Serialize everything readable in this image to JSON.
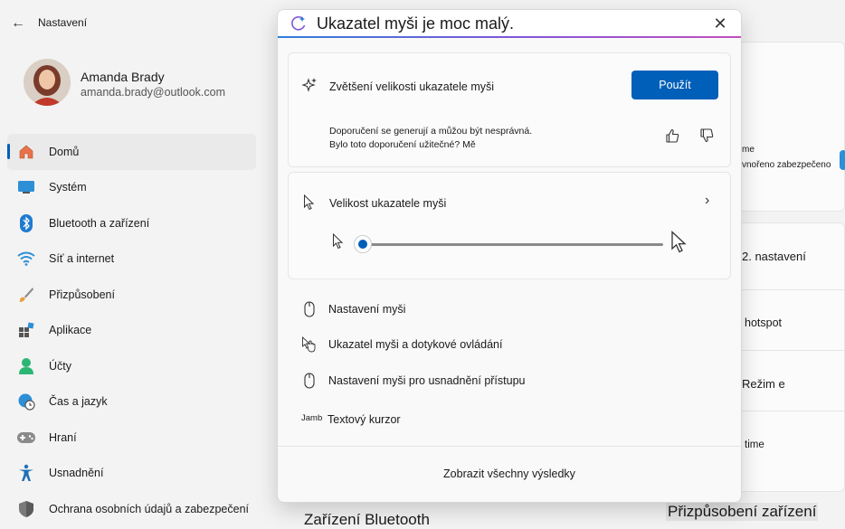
{
  "window": {
    "back_label": "←",
    "title": "Nastavení"
  },
  "profile": {
    "name": "Amanda Brady",
    "email": "amanda.brady@outlook.com"
  },
  "sidebar": {
    "items": [
      {
        "label": "Domů",
        "icon": "home-icon",
        "active": true
      },
      {
        "label": "Systém",
        "icon": "system-monitor-icon"
      },
      {
        "label": "Bluetooth a zařízení",
        "icon": "bluetooth-icon"
      },
      {
        "label": "Síť a internet",
        "icon": "wifi-icon"
      },
      {
        "label": "Přizpůsobení",
        "icon": "brush-icon"
      },
      {
        "label": "Aplikace",
        "icon": "apps-icon"
      },
      {
        "label": "Účty",
        "icon": "person-icon"
      },
      {
        "label": "Čas a jazyk",
        "icon": "globe-clock-icon"
      },
      {
        "label": "Hraní",
        "icon": "gamepad-icon"
      },
      {
        "label": "Usnadnění",
        "icon": "accessibility-icon"
      },
      {
        "label": "Ochrana osobních údajů a zabezpečení",
        "icon": "shield-icon"
      }
    ]
  },
  "background": {
    "frag_me": "me",
    "frag_security": "vnořeno zabezpečeno",
    "frag_settings2": "2. nastavení",
    "frag_hotspot": "hotspot",
    "frag_mode": "Režim e",
    "frag_time": "time",
    "bluetooth_heading": "Zařízení Bluetooth",
    "personalize_heading": "Přizpůsobení zařízení"
  },
  "search": {
    "query": "Ukazatel myši je moc malý.",
    "close_label": "✕"
  },
  "recommendation": {
    "title": "Zvětšení velikosti ukazatele myši",
    "apply_label": "Použít",
    "disclaimer_line1": "Doporučení se generují a můžou být nesprávná.",
    "disclaimer_line2": "Bylo toto doporučení užitečné? Mě"
  },
  "pointer_size": {
    "title": "Velikost ukazatele myši",
    "chevron": "›",
    "slider_value": 0.0
  },
  "results": [
    {
      "label": "Nastavení myši",
      "icon": "mouse-icon"
    },
    {
      "label": "Ukazatel myši a dotykové ovládání",
      "icon": "pointer-touch-icon"
    },
    {
      "label": "Nastavení myši pro usnadnění přístupu",
      "icon": "mouse-icon"
    }
  ],
  "text_cursor": {
    "prefix": "Jamb",
    "label": "Textový kurzor"
  },
  "footer": {
    "show_all_label": "Zobrazit všechny výsledky"
  },
  "colors": {
    "accent": "#005fb8",
    "background": "#f3f3f3"
  }
}
